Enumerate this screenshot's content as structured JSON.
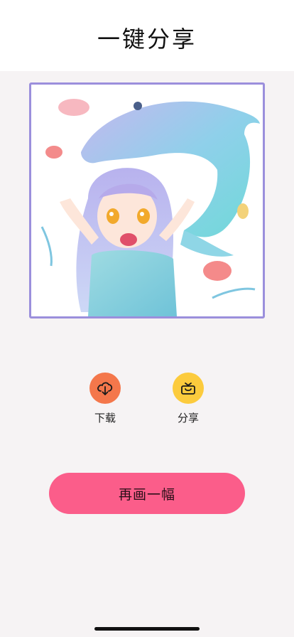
{
  "header": {
    "title": "一键分享"
  },
  "artwork": {
    "description_icon": "anime-girl-dolphin-illustration"
  },
  "actions": [
    {
      "label": "下载",
      "icon": "download-icon",
      "color": "#f4774b"
    },
    {
      "label": "分享",
      "icon": "share-basket-icon",
      "color": "#fccb3d"
    }
  ],
  "redraw_button": {
    "label": "再画一幅",
    "color": "#fb5d8a"
  }
}
